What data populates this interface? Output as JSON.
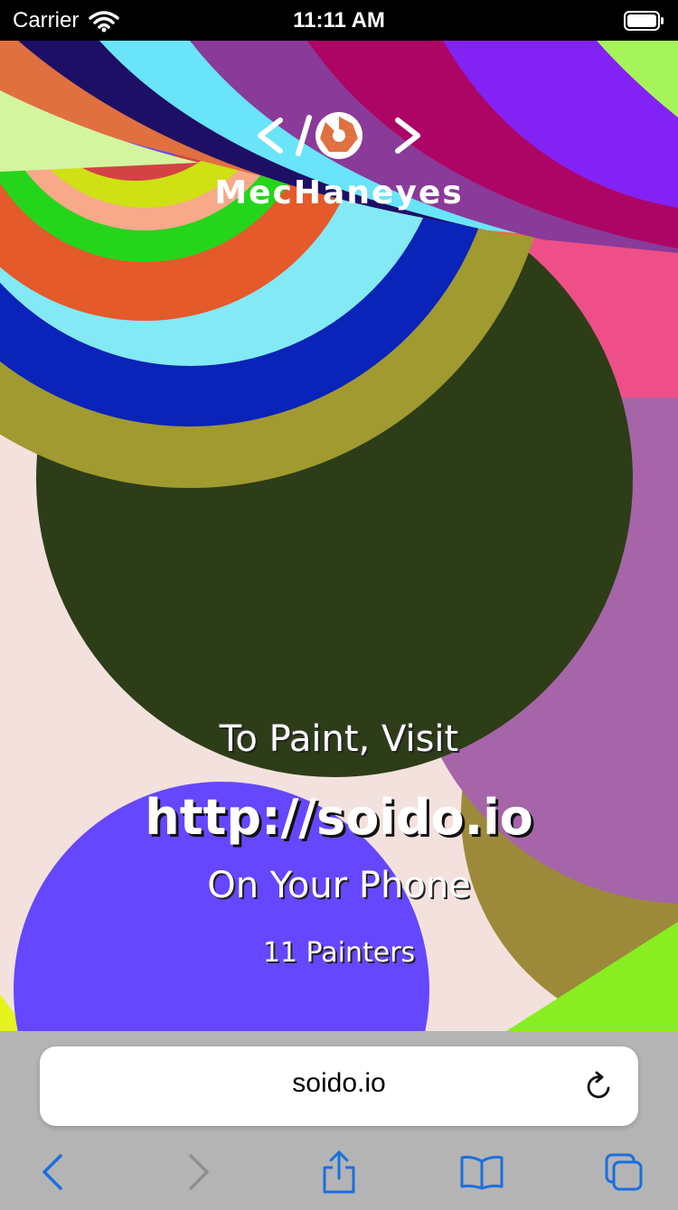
{
  "status_bar": {
    "carrier": "Carrier",
    "time": "11:11 AM",
    "wifi_icon": "wifi-icon",
    "battery_icon": "battery-icon"
  },
  "page": {
    "logo_text": "MecHaneyes",
    "logo_icon": "code-aperture-logo-icon",
    "visit_label": "To Paint, Visit",
    "url_label": "http://soido.io",
    "phone_label": "On Your Phone",
    "painters_label": "11 Painters"
  },
  "browser": {
    "address": "soido.io",
    "icons": [
      "reload-icon",
      "back-icon",
      "forward-icon",
      "share-icon",
      "bookmarks-icon",
      "tabs-icon"
    ]
  },
  "colors": {
    "accent": "#1a6fe0",
    "status_bar_bg": "#000000",
    "browser_bar_bg": "#b4b4b4"
  }
}
